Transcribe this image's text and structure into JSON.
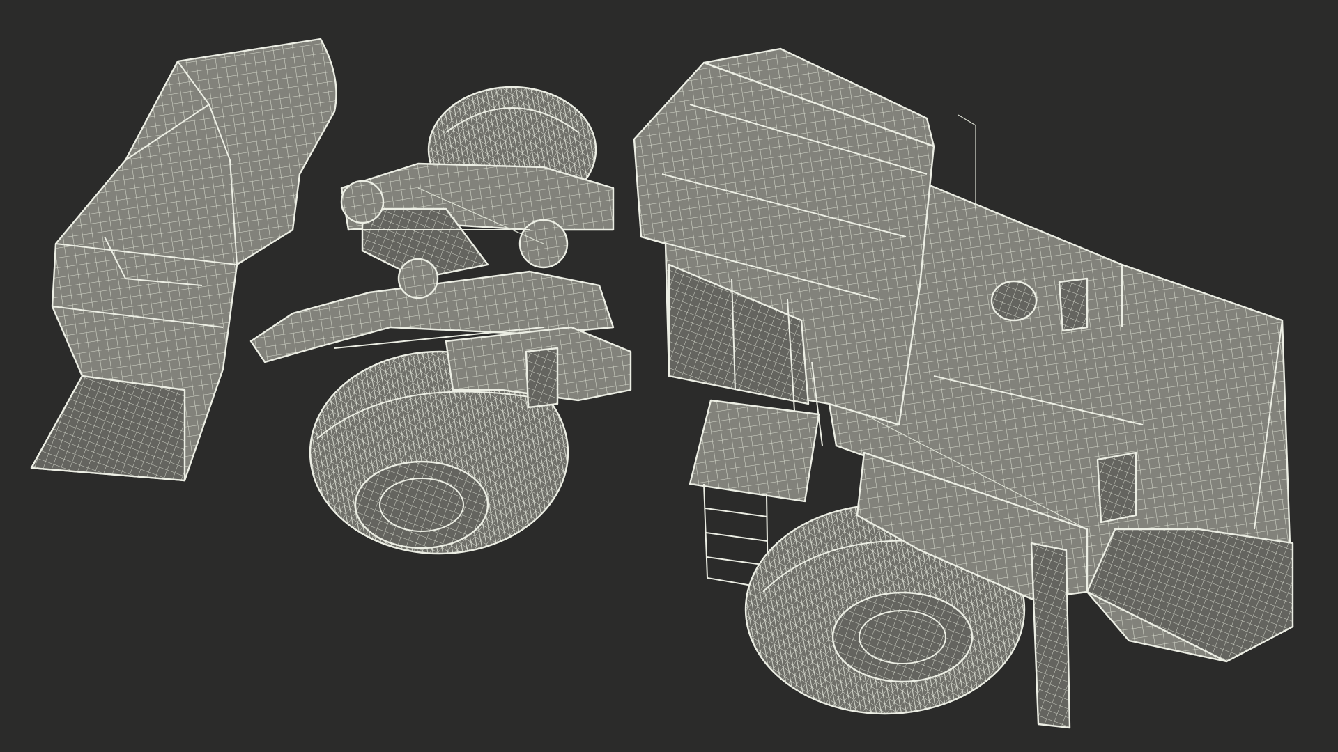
{
  "scene": {
    "background_color": "#2b2b2a",
    "wire_color": "#eceee4",
    "surface_color": "#80807a",
    "shadow_color": "#62625d"
  }
}
